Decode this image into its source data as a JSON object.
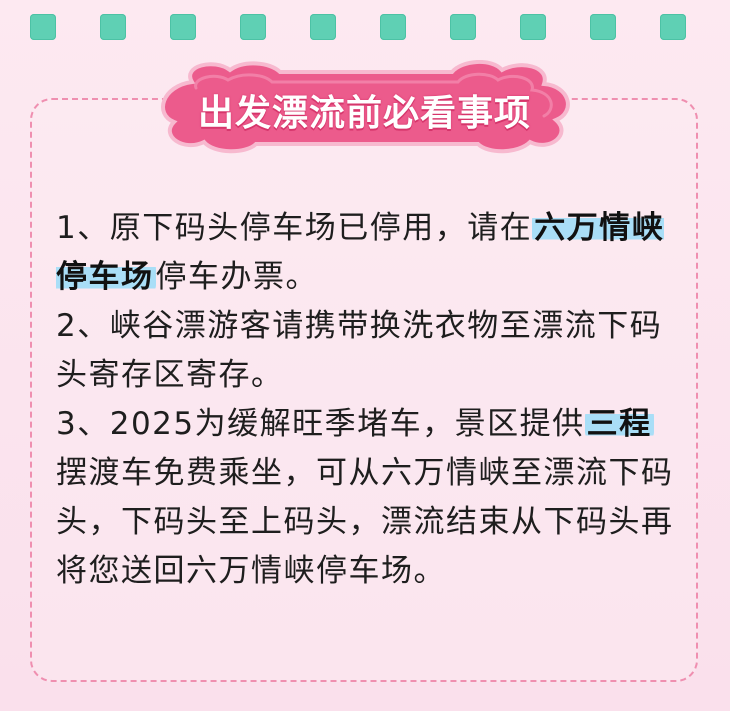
{
  "title": "出发漂流前必看事项",
  "notices": [
    {
      "segments": [
        {
          "text": "1、原下码头停车场已停用，请在",
          "highlight": false
        },
        {
          "text": "六万情峡停车场",
          "highlight": true
        },
        {
          "text": "停车办票。",
          "highlight": false
        }
      ]
    },
    {
      "segments": [
        {
          "text": "2、峡谷漂游客请携带换洗衣物至漂流下码头寄存区寄存。",
          "highlight": false
        }
      ]
    },
    {
      "segments": [
        {
          "text": "3、2025为缓解旺季堵车，景区提供",
          "highlight": false
        },
        {
          "text": "三程",
          "highlight": true
        },
        {
          "text": "摆渡车免费乘坐，可从六万情峡至漂流下码头，下码头至上码头，漂流结束从下码头再将您送回六万情峡停车场。",
          "highlight": false
        }
      ]
    }
  ],
  "colors": {
    "background": "#fbe7ef",
    "square": "#5fd0b4",
    "banner": "#ec5b8c",
    "border": "#ef8fb0",
    "highlight": "#a9def7"
  }
}
